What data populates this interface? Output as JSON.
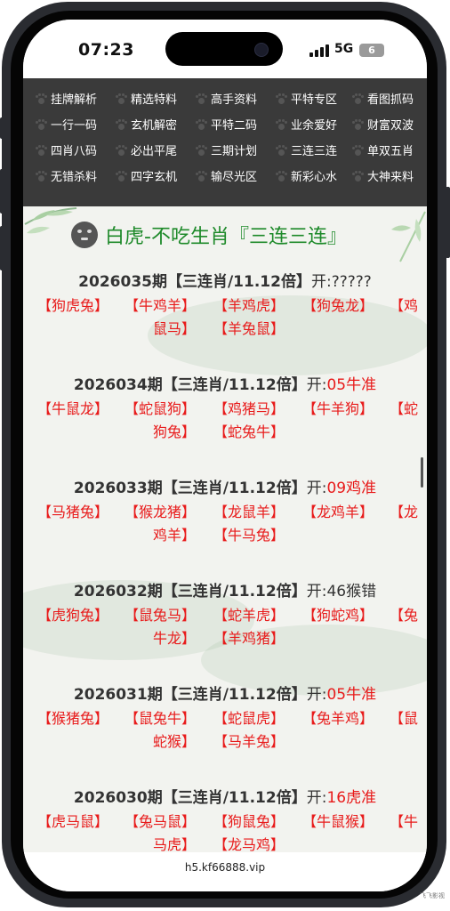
{
  "status": {
    "time": "07:23",
    "network": "5G",
    "battery": "6"
  },
  "menu": [
    "挂牌解析",
    "精选特料",
    "高手资料",
    "平特专区",
    "看图抓码",
    "一行一码",
    "玄机解密",
    "平特二码",
    "业余爱好",
    "财富双波",
    "四肖八码",
    "必出平尾",
    "三期计划",
    "三连三连",
    "单双五肖",
    "无错杀料",
    "四字玄机",
    "输尽光区",
    "新彩心水",
    "大神来料"
  ],
  "heading": "白虎-不吃生肖『三连三连』",
  "entries": [
    {
      "period": "2026035期【三连肖/11.12倍】",
      "open_label": "开:",
      "result": "?????",
      "result_color": "black",
      "picks": [
        "【狗虎兔】",
        "【牛鸡羊】",
        "【羊鸡虎】",
        "【狗兔龙】",
        "【鸡",
        "鼠马】",
        "【羊兔鼠】"
      ]
    },
    {
      "period": "2026034期【三连肖/11.12倍】",
      "open_label": "开:",
      "result": "05牛准",
      "result_color": "red",
      "picks": [
        "【牛鼠龙】",
        "【蛇鼠狗】",
        "【鸡猪马】",
        "【牛羊狗】",
        "【蛇",
        "狗兔】",
        "【蛇兔牛】"
      ]
    },
    {
      "period": "2026033期【三连肖/11.12倍】",
      "open_label": "开:",
      "result": "09鸡准",
      "result_color": "red",
      "picks": [
        "【马猪兔】",
        "【猴龙猪】",
        "【龙鼠羊】",
        "【龙鸡羊】",
        "【龙",
        "鸡羊】",
        "【牛马兔】"
      ]
    },
    {
      "period": "2026032期【三连肖/11.12倍】",
      "open_label": "开:",
      "result": "46猴错",
      "result_color": "black",
      "picks": [
        "【虎狗兔】",
        "【鼠兔马】",
        "【蛇羊虎】",
        "【狗蛇鸡】",
        "【兔",
        "牛龙】",
        "【羊鸡猪】"
      ]
    },
    {
      "period": "2026031期【三连肖/11.12倍】",
      "open_label": "开:",
      "result": "05牛准",
      "result_color": "red",
      "picks": [
        "【猴猪兔】",
        "【鼠兔牛】",
        "【蛇鼠虎】",
        "【兔羊鸡】",
        "【鼠",
        "蛇猴】",
        "【马羊兔】"
      ]
    },
    {
      "period": "2026030期【三连肖/11.12倍】",
      "open_label": "开:",
      "result": "16虎准",
      "result_color": "red",
      "picks": [
        "【虎马鼠】",
        "【兔马鼠】",
        "【狗鼠兔】",
        "【牛鼠猴】",
        "【牛",
        "马虎】",
        "【龙马鸡】"
      ]
    }
  ],
  "footer": {
    "url": "h5.kf66888.vip"
  },
  "watermark": "飞飞影视"
}
